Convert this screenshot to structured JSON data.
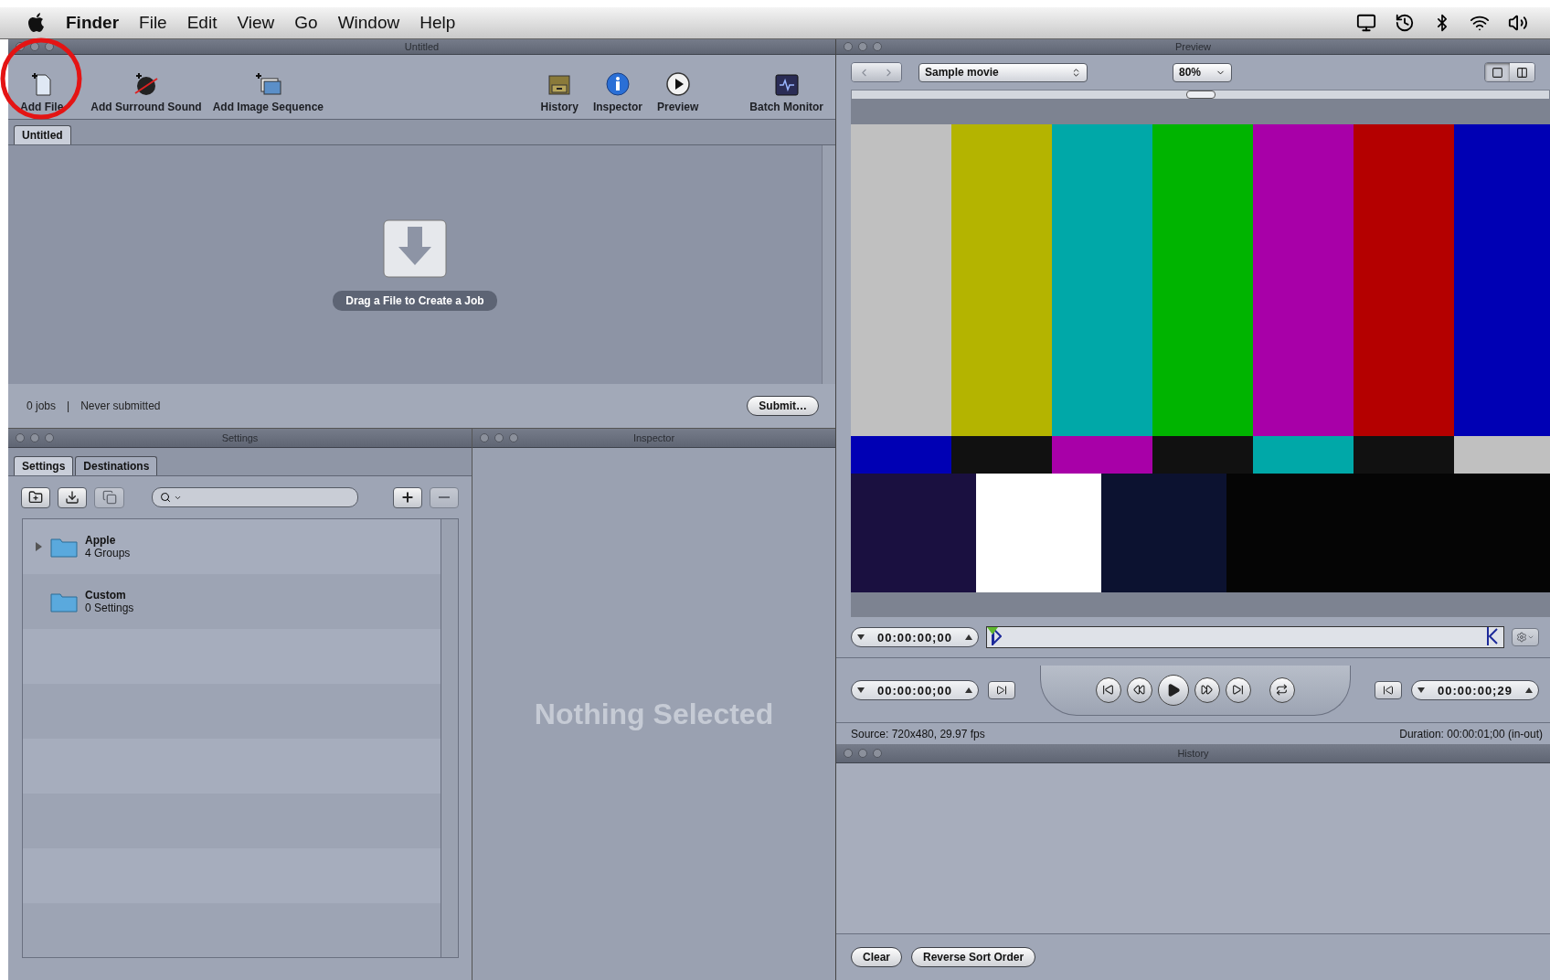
{
  "menu_bar": {
    "app": "Finder",
    "items": [
      "File",
      "Edit",
      "View",
      "Go",
      "Window",
      "Help"
    ]
  },
  "batch_window": {
    "title": "Untitled",
    "toolbar_left": [
      {
        "kind": "add-file",
        "label": "Add File"
      },
      {
        "kind": "surround-sound",
        "label": "Add Surround Sound"
      },
      {
        "kind": "image-sequence",
        "label": "Add Image Sequence"
      }
    ],
    "toolbar_right": [
      {
        "kind": "history",
        "label": "History"
      },
      {
        "kind": "inspector",
        "label": "Inspector"
      },
      {
        "kind": "preview",
        "label": "Preview"
      },
      {
        "kind": "batch-monitor",
        "label": "Batch Monitor"
      }
    ],
    "tabs": [
      {
        "label": "Untitled",
        "selected": true
      }
    ],
    "drop_hint": "Drag a File to Create a Job",
    "status": {
      "jobs": "0 jobs",
      "separator": "|",
      "submitted": "Never submitted"
    },
    "submit_button": "Submit…"
  },
  "settings_panel": {
    "title": "Settings",
    "tabs": [
      {
        "label": "Settings",
        "selected": true
      },
      {
        "label": "Destinations",
        "selected": false
      }
    ],
    "left_buttons": [
      {
        "kind": "new-folder",
        "disabled": false
      },
      {
        "kind": "import",
        "disabled": false
      },
      {
        "kind": "duplicate",
        "disabled": true
      }
    ],
    "right_buttons": [
      {
        "kind": "add",
        "disabled": false
      },
      {
        "kind": "remove",
        "disabled": true
      }
    ],
    "tree": [
      {
        "name": "Apple",
        "detail": "4 Groups",
        "expandable": true,
        "expanded": false
      },
      {
        "name": "Custom",
        "detail": "0 Settings",
        "expandable": false
      }
    ]
  },
  "inspector_panel": {
    "title": "Inspector",
    "empty_text": "Nothing Selected"
  },
  "preview_panel": {
    "title": "Preview",
    "source_menu": "Sample movie",
    "zoom_menu": "80%",
    "view_modes": [
      {
        "kind": "single",
        "selected": true
      },
      {
        "kind": "split",
        "selected": false
      }
    ],
    "in_timecode": "00:00:00;00",
    "playhead": {
      "level": 0
    },
    "current_timecode": "00:00:00;00",
    "out_timecode": "00:00:00;29",
    "source_info": "Source: 720x480, 29.97 fps",
    "duration": "Duration: 00:00:01;00 (in-out)"
  },
  "history_panel": {
    "title": "History",
    "buttons": [
      "Clear",
      "Reverse Sort Order"
    ]
  }
}
